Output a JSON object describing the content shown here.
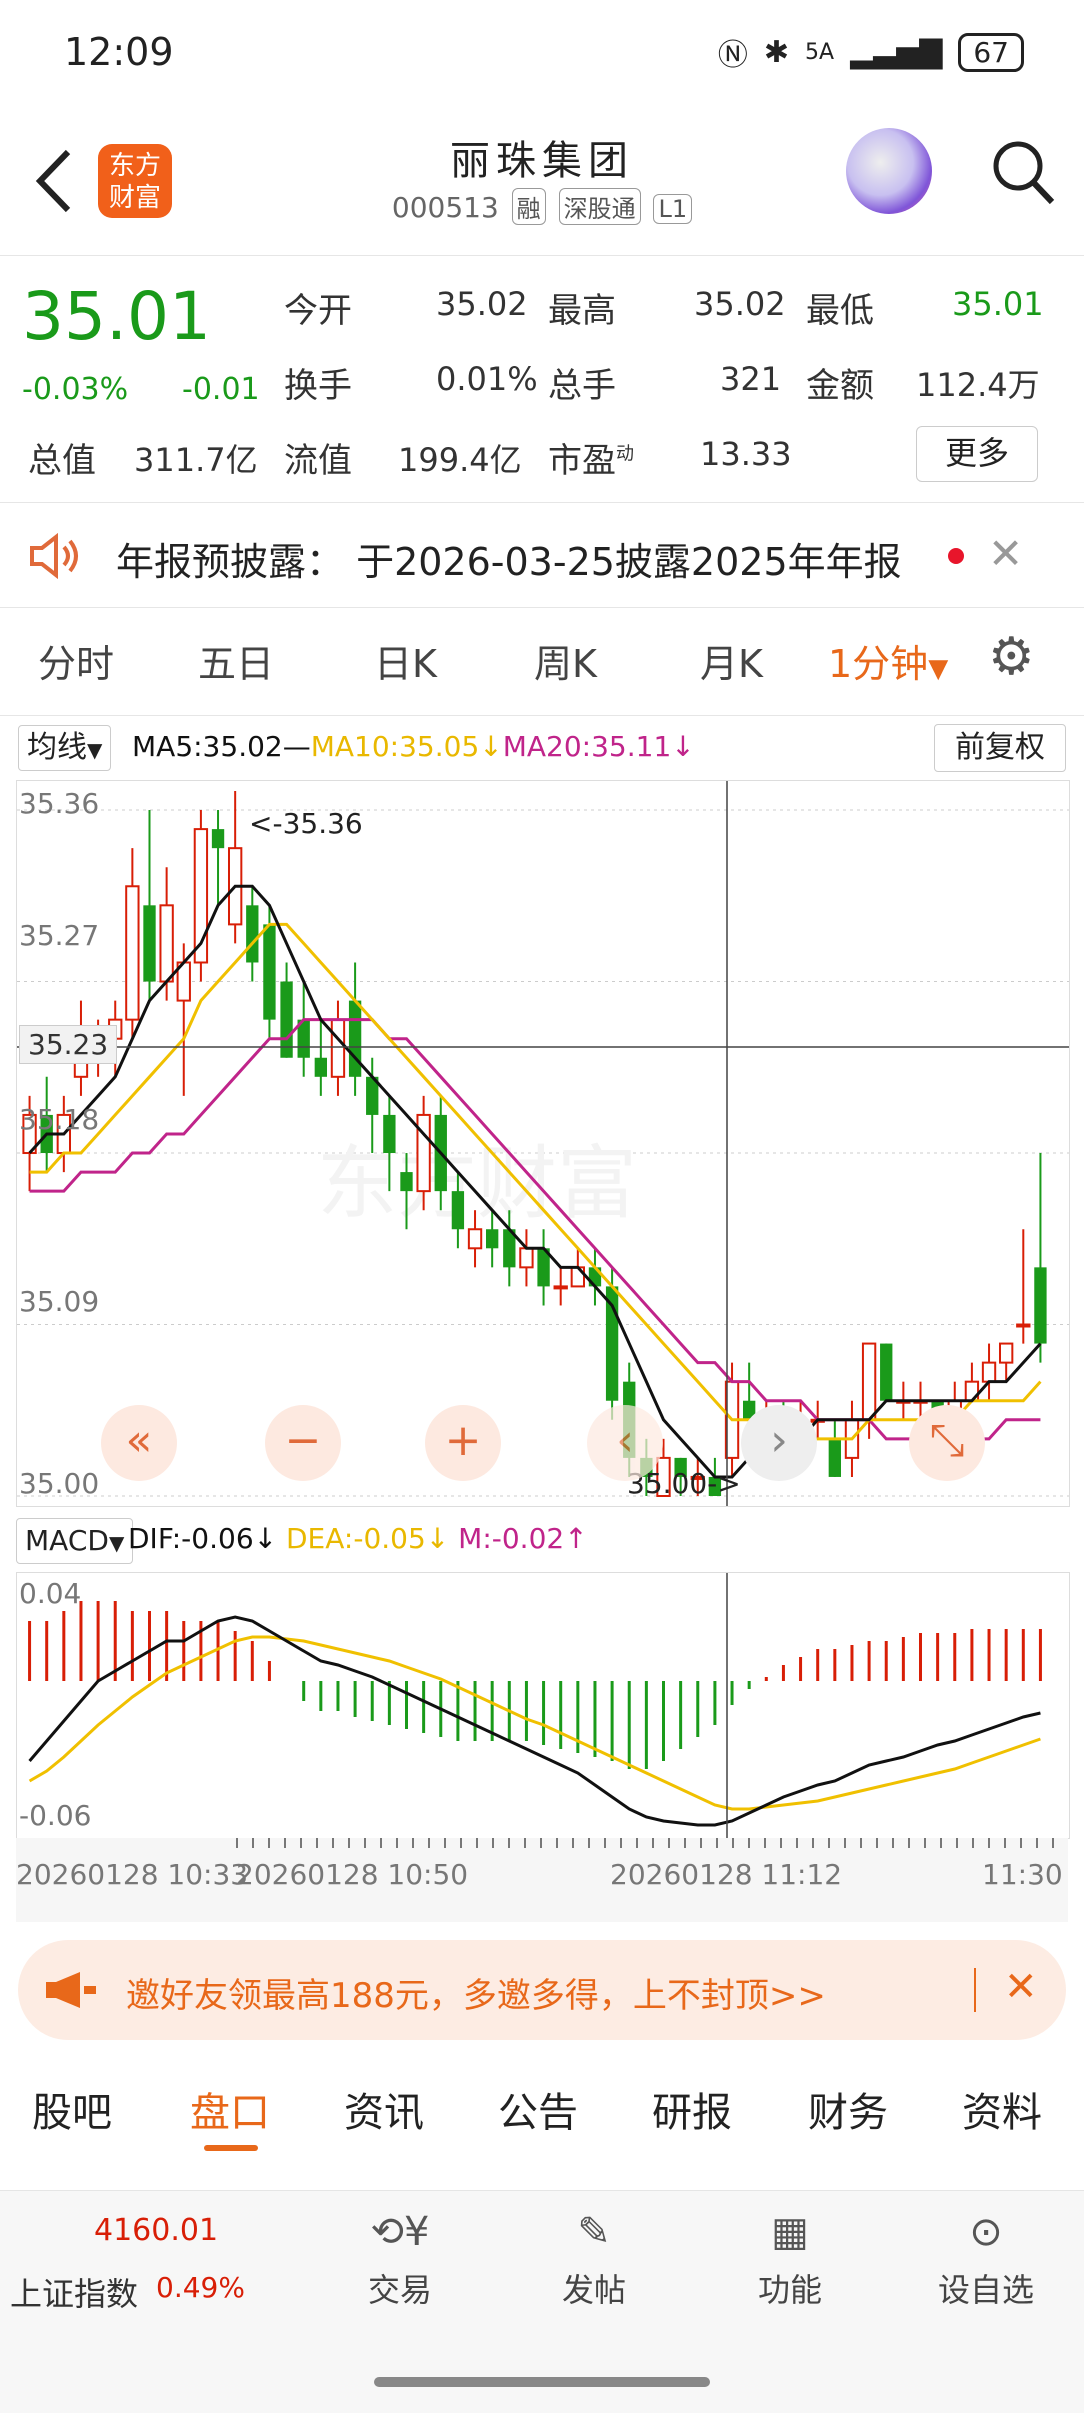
{
  "status": {
    "time": "12:09",
    "network": "5A",
    "battery": "67"
  },
  "header": {
    "logo_text": "东方财富",
    "stock_name": "丽珠集团",
    "code": "000513",
    "tags": [
      "融",
      "深股通",
      "L1"
    ]
  },
  "quote": {
    "price": "35.01",
    "change_pct": "-0.03%",
    "change": "-0.01",
    "fields": [
      {
        "label": "今开",
        "value": "35.02"
      },
      {
        "label": "最高",
        "value": "35.02"
      },
      {
        "label": "最低",
        "value": "35.01"
      },
      {
        "label": "换手",
        "value": "0.01%"
      },
      {
        "label": "总手",
        "value": "321"
      },
      {
        "label": "金额",
        "value": "112.4万"
      },
      {
        "label": "总值",
        "value": "311.7亿"
      },
      {
        "label": "流值",
        "value": "199.4亿"
      },
      {
        "label": "市盈",
        "sup": "动",
        "value": "13.33"
      }
    ],
    "more_button": "更多"
  },
  "notice": {
    "text": "年报预披露： 于2026-03-25披露2025年年报"
  },
  "period_tabs": [
    "分时",
    "五日",
    "日K",
    "周K",
    "月K",
    "1分钟"
  ],
  "ma_legend": {
    "selector": "均线",
    "ma5": "MA5:35.02",
    "ma10": "MA10:35.05↓",
    "ma20": "MA20:35.11↓",
    "adjust": "前复权"
  },
  "chart_data": {
    "type": "candlestick",
    "interval": "1分钟",
    "ylim": [
      35.0,
      35.37
    ],
    "y_ticks": [
      "35.36",
      "35.27",
      "35.18",
      "35.09",
      "35.00"
    ],
    "crosshair_price": "35.23",
    "max_marker": "<-35.36",
    "min_marker": "35.00->",
    "x_labels": [
      "20260128 10:33",
      "20260128 10:50",
      "20260128 11:12",
      "11:30"
    ],
    "candles": [
      {
        "o": 35.18,
        "c": 35.2,
        "h": 35.21,
        "l": 35.16
      },
      {
        "o": 35.2,
        "c": 35.18,
        "h": 35.22,
        "l": 35.17
      },
      {
        "o": 35.18,
        "c": 35.2,
        "h": 35.21,
        "l": 35.17
      },
      {
        "o": 35.22,
        "c": 35.24,
        "h": 35.26,
        "l": 35.21
      },
      {
        "o": 35.23,
        "c": 35.24,
        "h": 35.25,
        "l": 35.22
      },
      {
        "o": 35.24,
        "c": 35.25,
        "h": 35.26,
        "l": 35.22
      },
      {
        "o": 35.25,
        "c": 35.32,
        "h": 35.34,
        "l": 35.24
      },
      {
        "o": 35.31,
        "c": 35.27,
        "h": 35.36,
        "l": 35.26
      },
      {
        "o": 35.27,
        "c": 35.31,
        "h": 35.33,
        "l": 35.26
      },
      {
        "o": 35.26,
        "c": 35.28,
        "h": 35.29,
        "l": 35.21
      },
      {
        "o": 35.28,
        "c": 35.35,
        "h": 35.36,
        "l": 35.27
      },
      {
        "o": 35.35,
        "c": 35.34,
        "h": 35.36,
        "l": 35.31
      },
      {
        "o": 35.3,
        "c": 35.34,
        "h": 35.37,
        "l": 35.29
      },
      {
        "o": 35.31,
        "c": 35.28,
        "h": 35.32,
        "l": 35.27
      },
      {
        "o": 35.3,
        "c": 35.25,
        "h": 35.31,
        "l": 35.24
      },
      {
        "o": 35.27,
        "c": 35.23,
        "h": 35.28,
        "l": 35.23
      },
      {
        "o": 35.25,
        "c": 35.23,
        "h": 35.27,
        "l": 35.22
      },
      {
        "o": 35.23,
        "c": 35.22,
        "h": 35.25,
        "l": 35.21
      },
      {
        "o": 35.22,
        "c": 35.25,
        "h": 35.26,
        "l": 35.21
      },
      {
        "o": 35.26,
        "c": 35.22,
        "h": 35.28,
        "l": 35.21
      },
      {
        "o": 35.22,
        "c": 35.2,
        "h": 35.23,
        "l": 35.18
      },
      {
        "o": 35.2,
        "c": 35.18,
        "h": 35.21,
        "l": 35.16
      },
      {
        "o": 35.17,
        "c": 35.16,
        "h": 35.18,
        "l": 35.14
      },
      {
        "o": 35.16,
        "c": 35.2,
        "h": 35.21,
        "l": 35.15
      },
      {
        "o": 35.2,
        "c": 35.16,
        "h": 35.21,
        "l": 35.15
      },
      {
        "o": 35.16,
        "c": 35.14,
        "h": 35.17,
        "l": 35.13
      },
      {
        "o": 35.13,
        "c": 35.14,
        "h": 35.15,
        "l": 35.12
      },
      {
        "o": 35.14,
        "c": 35.13,
        "h": 35.15,
        "l": 35.12
      },
      {
        "o": 35.14,
        "c": 35.12,
        "h": 35.15,
        "l": 35.11
      },
      {
        "o": 35.12,
        "c": 35.13,
        "h": 35.14,
        "l": 35.11
      },
      {
        "o": 35.13,
        "c": 35.11,
        "h": 35.14,
        "l": 35.1
      },
      {
        "o": 35.11,
        "c": 35.11,
        "h": 35.12,
        "l": 35.1
      },
      {
        "o": 35.11,
        "c": 35.12,
        "h": 35.13,
        "l": 35.11
      },
      {
        "o": 35.12,
        "c": 35.11,
        "h": 35.13,
        "l": 35.1
      },
      {
        "o": 35.11,
        "c": 35.05,
        "h": 35.12,
        "l": 35.04
      },
      {
        "o": 35.06,
        "c": 35.02,
        "h": 35.07,
        "l": 35.01
      },
      {
        "o": 35.02,
        "c": 35.01,
        "h": 35.03,
        "l": 35.0
      },
      {
        "o": 35.0,
        "c": 35.02,
        "h": 35.03,
        "l": 35.0
      },
      {
        "o": 35.02,
        "c": 35.01,
        "h": 35.02,
        "l": 35.0
      },
      {
        "o": 35.01,
        "c": 35.01,
        "h": 35.02,
        "l": 35.0
      },
      {
        "o": 35.01,
        "c": 35.0,
        "h": 35.02,
        "l": 35.0
      },
      {
        "o": 35.02,
        "c": 35.06,
        "h": 35.07,
        "l": 35.01
      },
      {
        "o": 35.05,
        "c": 35.04,
        "h": 35.07,
        "l": 35.03
      },
      {
        "o": 35.04,
        "c": 35.04,
        "h": 35.05,
        "l": 35.03
      },
      {
        "o": 35.04,
        "c": 35.03,
        "h": 35.05,
        "l": 35.02
      },
      {
        "o": 35.03,
        "c": 35.04,
        "h": 35.05,
        "l": 35.02
      },
      {
        "o": 35.04,
        "c": 35.04,
        "h": 35.05,
        "l": 35.03
      },
      {
        "o": 35.03,
        "c": 35.01,
        "h": 35.04,
        "l": 35.01
      },
      {
        "o": 35.02,
        "c": 35.04,
        "h": 35.05,
        "l": 35.01
      },
      {
        "o": 35.04,
        "c": 35.08,
        "h": 35.08,
        "l": 35.03
      },
      {
        "o": 35.08,
        "c": 35.05,
        "h": 35.08,
        "l": 35.05
      },
      {
        "o": 35.05,
        "c": 35.05,
        "h": 35.06,
        "l": 35.04
      },
      {
        "o": 35.05,
        "c": 35.05,
        "h": 35.06,
        "l": 35.04
      },
      {
        "o": 35.05,
        "c": 35.04,
        "h": 35.05,
        "l": 35.03
      },
      {
        "o": 35.04,
        "c": 35.05,
        "h": 35.06,
        "l": 35.03
      },
      {
        "o": 35.05,
        "c": 35.06,
        "h": 35.07,
        "l": 35.05
      },
      {
        "o": 35.06,
        "c": 35.07,
        "h": 35.08,
        "l": 35.05
      },
      {
        "o": 35.07,
        "c": 35.08,
        "h": 35.08,
        "l": 35.06
      },
      {
        "o": 35.09,
        "c": 35.09,
        "h": 35.14,
        "l": 35.08
      },
      {
        "o": 35.12,
        "c": 35.08,
        "h": 35.18,
        "l": 35.07
      }
    ],
    "ma5": [
      35.18,
      35.19,
      35.19,
      35.2,
      35.21,
      35.22,
      35.24,
      35.26,
      35.27,
      35.28,
      35.29,
      35.31,
      35.32,
      35.32,
      35.31,
      35.29,
      35.27,
      35.25,
      35.24,
      35.23,
      35.22,
      35.21,
      35.2,
      35.19,
      35.18,
      35.17,
      35.16,
      35.15,
      35.14,
      35.13,
      35.13,
      35.12,
      35.12,
      35.11,
      35.1,
      35.08,
      35.06,
      35.04,
      35.03,
      35.02,
      35.01,
      35.01,
      35.02,
      35.02,
      35.03,
      35.03,
      35.04,
      35.04,
      35.04,
      35.04,
      35.05,
      35.05,
      35.05,
      35.05,
      35.05,
      35.05,
      35.06,
      35.06,
      35.07,
      35.08
    ],
    "ma10": [
      35.17,
      35.17,
      35.18,
      35.18,
      35.19,
      35.2,
      35.21,
      35.22,
      35.23,
      35.24,
      35.26,
      35.27,
      35.28,
      35.29,
      35.3,
      35.3,
      35.29,
      35.28,
      35.27,
      35.26,
      35.25,
      35.24,
      35.23,
      35.22,
      35.21,
      35.2,
      35.19,
      35.18,
      35.17,
      35.16,
      35.15,
      35.14,
      35.13,
      35.12,
      35.11,
      35.1,
      35.09,
      35.08,
      35.07,
      35.06,
      35.05,
      35.04,
      35.04,
      35.03,
      35.03,
      35.03,
      35.03,
      35.03,
      35.03,
      35.04,
      35.04,
      35.04,
      35.04,
      35.04,
      35.04,
      35.05,
      35.05,
      35.05,
      35.05,
      35.06
    ],
    "ma20": [
      35.16,
      35.16,
      35.16,
      35.17,
      35.17,
      35.17,
      35.18,
      35.18,
      35.19,
      35.19,
      35.2,
      35.21,
      35.22,
      35.23,
      35.24,
      35.24,
      35.25,
      35.25,
      35.25,
      35.25,
      35.25,
      35.24,
      35.24,
      35.23,
      35.22,
      35.21,
      35.2,
      35.19,
      35.18,
      35.17,
      35.16,
      35.15,
      35.14,
      35.13,
      35.12,
      35.11,
      35.1,
      35.09,
      35.08,
      35.07,
      35.07,
      35.06,
      35.06,
      35.05,
      35.05,
      35.05,
      35.04,
      35.04,
      35.04,
      35.04,
      35.03,
      35.03,
      35.03,
      35.03,
      35.03,
      35.03,
      35.03,
      35.04,
      35.04,
      35.04
    ],
    "macd": {
      "selector": "MACD",
      "dif_label": "DIF:-0.06↓",
      "dea_label": "DEA:-0.05↓",
      "m_label": "M:-0.02↑",
      "ylim": [
        -0.075,
        0.05
      ],
      "y_ticks": [
        "0.04",
        "-0.06"
      ],
      "dif": [
        -0.04,
        -0.03,
        -0.02,
        -0.01,
        0.0,
        0.005,
        0.01,
        0.015,
        0.02,
        0.02,
        0.025,
        0.03,
        0.032,
        0.03,
        0.025,
        0.02,
        0.015,
        0.01,
        0.008,
        0.005,
        0.002,
        -0.002,
        -0.006,
        -0.01,
        -0.014,
        -0.018,
        -0.022,
        -0.026,
        -0.03,
        -0.034,
        -0.038,
        -0.042,
        -0.046,
        -0.052,
        -0.058,
        -0.064,
        -0.068,
        -0.07,
        -0.071,
        -0.072,
        -0.072,
        -0.07,
        -0.066,
        -0.062,
        -0.058,
        -0.055,
        -0.052,
        -0.05,
        -0.046,
        -0.042,
        -0.04,
        -0.038,
        -0.035,
        -0.032,
        -0.03,
        -0.027,
        -0.024,
        -0.021,
        -0.018,
        -0.016
      ],
      "dea": [
        -0.05,
        -0.045,
        -0.038,
        -0.03,
        -0.022,
        -0.015,
        -0.008,
        -0.002,
        0.004,
        0.008,
        0.012,
        0.016,
        0.02,
        0.022,
        0.022,
        0.021,
        0.02,
        0.018,
        0.016,
        0.014,
        0.012,
        0.01,
        0.007,
        0.004,
        0.001,
        -0.003,
        -0.007,
        -0.011,
        -0.015,
        -0.019,
        -0.022,
        -0.026,
        -0.03,
        -0.034,
        -0.038,
        -0.042,
        -0.046,
        -0.05,
        -0.054,
        -0.058,
        -0.062,
        -0.064,
        -0.064,
        -0.063,
        -0.062,
        -0.061,
        -0.06,
        -0.058,
        -0.056,
        -0.054,
        -0.052,
        -0.05,
        -0.048,
        -0.046,
        -0.044,
        -0.041,
        -0.038,
        -0.035,
        -0.032,
        -0.029
      ],
      "m": [
        0.03,
        0.03,
        0.035,
        0.04,
        0.04,
        0.04,
        0.035,
        0.035,
        0.035,
        0.03,
        0.03,
        0.03,
        0.025,
        0.02,
        0.01,
        0.0,
        -0.01,
        -0.015,
        -0.015,
        -0.018,
        -0.02,
        -0.022,
        -0.024,
        -0.026,
        -0.028,
        -0.03,
        -0.03,
        -0.03,
        -0.03,
        -0.03,
        -0.032,
        -0.034,
        -0.036,
        -0.038,
        -0.04,
        -0.044,
        -0.044,
        -0.04,
        -0.034,
        -0.028,
        -0.022,
        -0.012,
        -0.004,
        0.002,
        0.008,
        0.012,
        0.016,
        0.016,
        0.018,
        0.02,
        0.02,
        0.022,
        0.024,
        0.024,
        0.024,
        0.026,
        0.026,
        0.026,
        0.026,
        0.026
      ]
    }
  },
  "chart_controls": [
    "«",
    "−",
    "+",
    "‹",
    "›",
    "⤡"
  ],
  "banner": {
    "text": "邀好友领最高188元，多邀多得，上不封顶>>"
  },
  "bottom_tabs": [
    "股吧",
    "盘口",
    "资讯",
    "公告",
    "研报",
    "财务",
    "资料"
  ],
  "footer": {
    "index_value": "4160.01",
    "index_name": "上证指数",
    "index_change": "0.49%",
    "items": [
      {
        "label": "交易",
        "icon": "trade-icon"
      },
      {
        "label": "发帖",
        "icon": "post-icon"
      },
      {
        "label": "功能",
        "icon": "grid-icon"
      },
      {
        "label": "设自选",
        "icon": "more-icon"
      }
    ]
  },
  "colors": {
    "up": "#d81e06",
    "down": "#1a9a1a",
    "accent": "#f1601a",
    "ma5": "#111111",
    "ma10": "#f0c000",
    "ma20": "#c0248a"
  }
}
